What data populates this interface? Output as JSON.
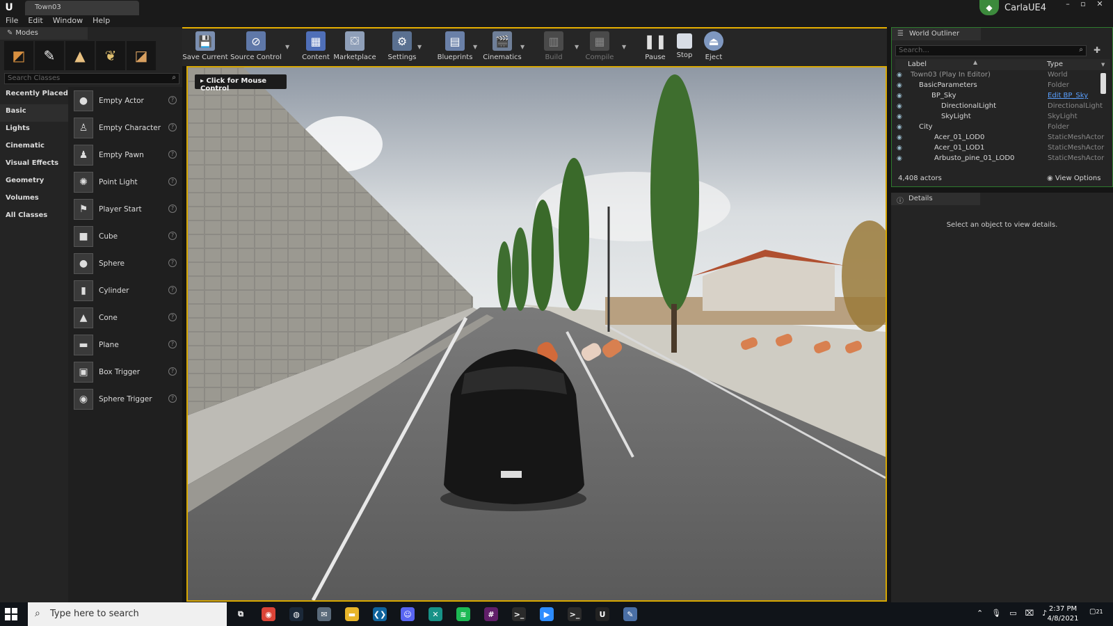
{
  "title_bar": {
    "tab_title": "Town03",
    "project_name": "CarlaUE4"
  },
  "menu": [
    "File",
    "Edit",
    "Window",
    "Help"
  ],
  "modes_panel": {
    "tab_title": "Modes",
    "search_placeholder": "Search Classes",
    "categories": [
      "Recently Placed",
      "Basic",
      "Lights",
      "Cinematic",
      "Visual Effects",
      "Geometry",
      "Volumes",
      "All Classes"
    ],
    "active_category": "Basic",
    "classes": [
      {
        "label": "Empty Actor",
        "icon": "sphere-icon"
      },
      {
        "label": "Empty Character",
        "icon": "character-icon"
      },
      {
        "label": "Empty Pawn",
        "icon": "pawn-icon"
      },
      {
        "label": "Point Light",
        "icon": "bulb-icon"
      },
      {
        "label": "Player Start",
        "icon": "flag-icon"
      },
      {
        "label": "Cube",
        "icon": "cube-icon"
      },
      {
        "label": "Sphere",
        "icon": "sphere-icon"
      },
      {
        "label": "Cylinder",
        "icon": "cylinder-icon"
      },
      {
        "label": "Cone",
        "icon": "cone-icon"
      },
      {
        "label": "Plane",
        "icon": "plane-icon"
      },
      {
        "label": "Box Trigger",
        "icon": "box-trigger-icon"
      },
      {
        "label": "Sphere Trigger",
        "icon": "sphere-trigger-icon"
      }
    ]
  },
  "toolbar": {
    "buttons": [
      {
        "label": "Save Current",
        "enabled": true
      },
      {
        "label": "Source Control",
        "enabled": true
      },
      {
        "label": "Content",
        "enabled": true
      },
      {
        "label": "Marketplace",
        "enabled": true
      },
      {
        "label": "Settings",
        "enabled": true
      },
      {
        "label": "Blueprints",
        "enabled": true
      },
      {
        "label": "Cinematics",
        "enabled": true
      },
      {
        "label": "Build",
        "enabled": false
      },
      {
        "label": "Compile",
        "enabled": false
      },
      {
        "label": "Pause",
        "enabled": true
      },
      {
        "label": "Stop",
        "enabled": true
      },
      {
        "label": "Eject",
        "enabled": true
      }
    ]
  },
  "viewport": {
    "hint": "Click for Mouse Control"
  },
  "outliner": {
    "tab_title": "World Outliner",
    "search_placeholder": "Search...",
    "col_label": "Label",
    "col_type": "Type",
    "rows": [
      {
        "label": "Town03 (Play In Editor)",
        "type": "World",
        "indent": 0
      },
      {
        "label": "BasicParameters",
        "type": "Folder",
        "indent": 1
      },
      {
        "label": "BP_Sky",
        "type": "Edit BP_Sky",
        "indent": 2
      },
      {
        "label": "DirectionalLight",
        "type": "DirectionalLight",
        "indent": 3
      },
      {
        "label": "SkyLight",
        "type": "SkyLight",
        "indent": 3
      },
      {
        "label": "City",
        "type": "Folder",
        "indent": 1
      },
      {
        "label": "Acer_01_LOD0",
        "type": "StaticMeshActor",
        "indent": 2
      },
      {
        "label": "Acer_01_LOD1",
        "type": "StaticMeshActor",
        "indent": 2
      },
      {
        "label": "Arbusto_pine_01_LOD0",
        "type": "StaticMeshActor",
        "indent": 2
      }
    ],
    "actor_count": "4,408 actors",
    "view_options": "View Options"
  },
  "details": {
    "tab_title": "Details",
    "empty_message": "Select an object to view details."
  },
  "taskbar": {
    "search_placeholder": "Type here to search",
    "apps": [
      {
        "name": "task-view-icon",
        "glyph": "⧉",
        "color": "#101419"
      },
      {
        "name": "chrome-icon",
        "glyph": "◉",
        "color": "#db4437"
      },
      {
        "name": "steam-icon",
        "glyph": "◍",
        "color": "#1b2838"
      },
      {
        "name": "mail-icon",
        "glyph": "✉",
        "color": "#5a6a7a"
      },
      {
        "name": "file-explorer-icon",
        "glyph": "▬",
        "color": "#e8b52a"
      },
      {
        "name": "vscode-icon",
        "glyph": "❮❯",
        "color": "#0e639c"
      },
      {
        "name": "discord-icon",
        "glyph": "☺",
        "color": "#5865f2"
      },
      {
        "name": "gitkraken-icon",
        "glyph": "✕",
        "color": "#179287"
      },
      {
        "name": "spotify-icon",
        "glyph": "≋",
        "color": "#1db954"
      },
      {
        "name": "slack-icon",
        "glyph": "#",
        "color": "#611f69"
      },
      {
        "name": "terminal-icon",
        "glyph": ">_",
        "color": "#2b2b2b"
      },
      {
        "name": "zoom-icon",
        "glyph": "▶",
        "color": "#2d8cff"
      },
      {
        "name": "terminal2-icon",
        "glyph": ">_",
        "color": "#2b2b2b"
      },
      {
        "name": "unreal-icon",
        "glyph": "U",
        "color": "#222"
      },
      {
        "name": "paint-icon",
        "glyph": "✎",
        "color": "#4a6fa5"
      }
    ],
    "time": "2:37 PM",
    "date": "4/8/2021",
    "notifications": "21"
  }
}
